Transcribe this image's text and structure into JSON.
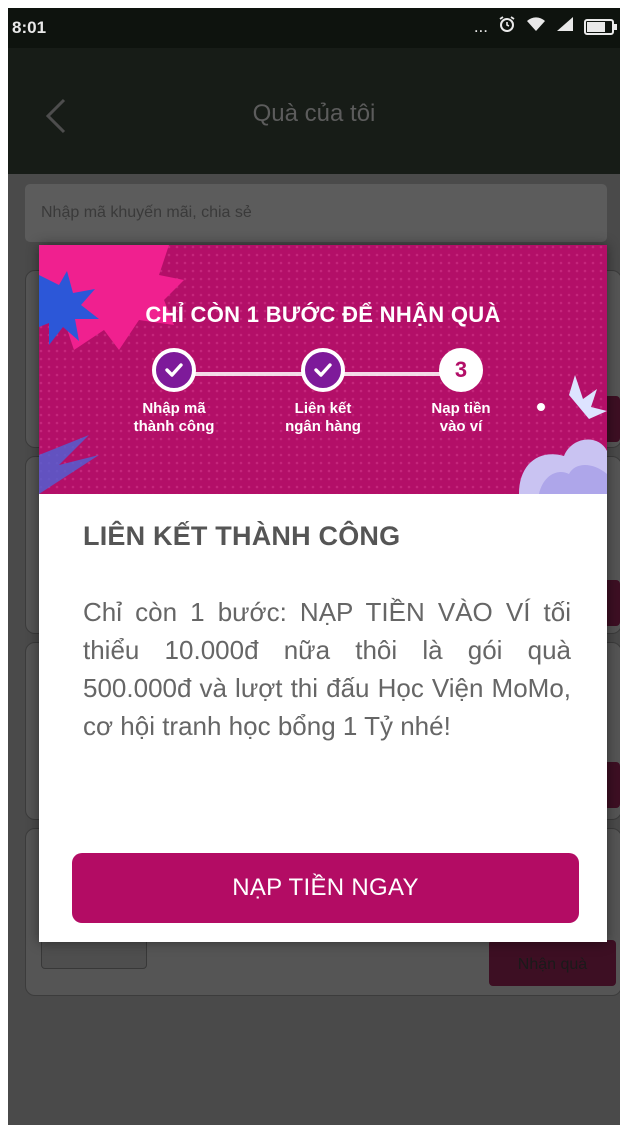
{
  "status_bar": {
    "time": "8:01",
    "dots": "...",
    "alarm_icon": "alarm-icon",
    "wifi_icon": "wifi-icon",
    "signal_icon": "signal-icon",
    "battery_icon": "battery-icon"
  },
  "header": {
    "title": "Quà của tôi",
    "back_icon": "chevron-left-icon"
  },
  "search": {
    "placeholder": "Nhập mã khuyến mãi, chia sẻ"
  },
  "background": {
    "redeem_label": "Nhận quà"
  },
  "modal": {
    "banner_title": "CHỈ CÒN 1 BƯỚC ĐỂ NHẬN QUÀ",
    "steps": [
      {
        "line1": "Nhập mã",
        "line2": "thành công",
        "status": "done",
        "icon": "check-icon"
      },
      {
        "line1": "Liên kết",
        "line2": "ngân hàng",
        "status": "done",
        "icon": "check-icon"
      },
      {
        "line1": "Nạp tiền",
        "line2": "vào ví",
        "status": "current",
        "number": "3"
      }
    ],
    "heading": "LIÊN KẾT THÀNH CÔNG",
    "body": "Chỉ còn 1 bước: NẠP TIỀN VÀO VÍ tối thiểu 10.000đ nữa thôi là gói quà 500.000đ và lượt thi đấu Học Viện MoMo, cơ hội tranh học bổng 1 Tỷ nhé!",
    "cta_label": "NẠP TIỀN NGAY"
  },
  "colors": {
    "brand": "#b30f68",
    "cta": "#b30c64",
    "step_done": "#7e1a9a"
  }
}
